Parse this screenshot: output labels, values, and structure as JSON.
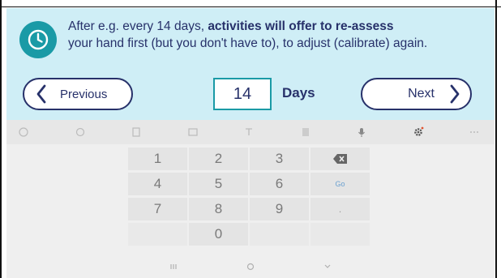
{
  "info": {
    "text_before": "After e.g. every 14 days, ",
    "text_bold": "activities will offer to re-assess",
    "text_after": "your hand first (but you don't have to), to adjust (calibrate) again.",
    "icon": "clock-icon"
  },
  "nav": {
    "previous_label": "Previous",
    "next_label": "Next",
    "days_value": "14",
    "days_label": "Days"
  },
  "keyboard": {
    "toolbar_icons": [
      "translate-icon",
      "emoji-icon",
      "clipboard-icon",
      "keyboard-layout-icon",
      "text-format-icon",
      "notes-icon",
      "microphone-icon",
      "settings-icon",
      "more-icon"
    ],
    "rows": [
      [
        "1",
        "2",
        "3",
        "backspace"
      ],
      [
        "4",
        "5",
        "6",
        "Go"
      ],
      [
        "7",
        "8",
        "9",
        "."
      ],
      [
        "",
        "0",
        "",
        ""
      ]
    ]
  },
  "colors": {
    "background": "#cfeef6",
    "accent": "#1a9aa6",
    "text": "#27316a"
  }
}
